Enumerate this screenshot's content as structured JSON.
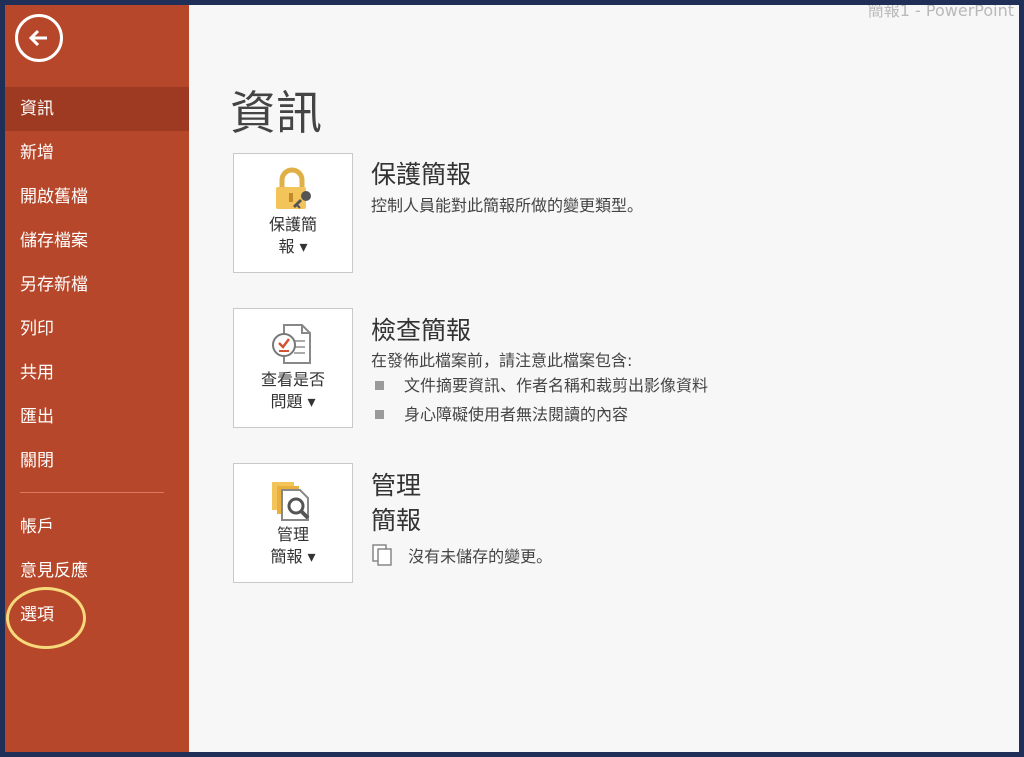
{
  "window": {
    "title": "簡報1  -  PowerPoint"
  },
  "sidebar": {
    "back_icon": "back-arrow-icon",
    "items": [
      {
        "label": "資訊",
        "selected": true
      },
      {
        "label": "新增"
      },
      {
        "label": "開啟舊檔"
      },
      {
        "label": "儲存檔案"
      },
      {
        "label": "另存新檔"
      },
      {
        "label": "列印"
      },
      {
        "label": "共用"
      },
      {
        "label": "匯出"
      },
      {
        "label": "關閉"
      },
      {
        "label": "帳戶"
      },
      {
        "label": "意見反應"
      },
      {
        "label": "選項"
      }
    ],
    "accent": "#b7472a",
    "selected_color": "#9e3a21"
  },
  "main": {
    "title": "資訊",
    "protect": {
      "button_line1": "保護簡",
      "button_line2": "報 ▾",
      "heading": "保護簡報",
      "description": "控制人員能對此簡報所做的變更類型。",
      "icon": "lock-key-icon"
    },
    "inspect": {
      "button_line1": "查看是否",
      "button_line2": "問題 ▾",
      "heading": "檢查簡報",
      "description": "在發佈此檔案前，請注意此檔案包含:",
      "bullets": [
        "文件摘要資訊、作者名稱和裁剪出影像資料",
        "身心障礙使用者無法閱讀的內容"
      ],
      "icon": "inspect-document-icon"
    },
    "manage": {
      "button_line1": "管理",
      "button_line2": "簡報 ▾",
      "heading_line1": "管理",
      "heading_line2": "簡報",
      "status": "沒有未儲存的變更。",
      "icon": "manage-documents-icon",
      "status_icon": "documents-icon"
    }
  }
}
